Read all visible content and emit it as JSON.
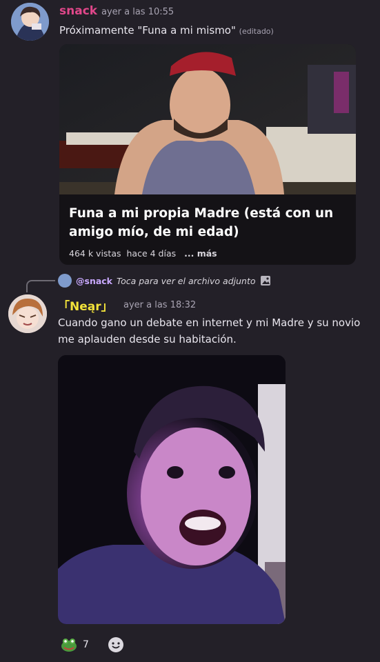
{
  "message1": {
    "author": "snack",
    "timestamp": "ayer a las 10:55",
    "text": "Próximamente \"Funa a mi mismo\"",
    "edited": "(editado)",
    "embed": {
      "title": "Funa a mi propia Madre (está con un amigo mío, de mi edad)",
      "views": "464 k vistas",
      "age": "hace 4 días",
      "more": "... más"
    }
  },
  "message2": {
    "reply": {
      "mention": "@snack",
      "text": "Toca para ver el archivo adjunto"
    },
    "author": "「Neąr」",
    "timestamp": "ayer a las 18:32",
    "text": "Cuando gano un debate en internet y mi Madre y su novio me aplauden desde su habitación.",
    "reaction": {
      "icon": "frog-emoji-icon",
      "count": "7"
    }
  },
  "colors": {
    "background": "#232028",
    "author1": "#e0478a",
    "author2": "#f2e23a",
    "mention": "#c9a9ff"
  }
}
